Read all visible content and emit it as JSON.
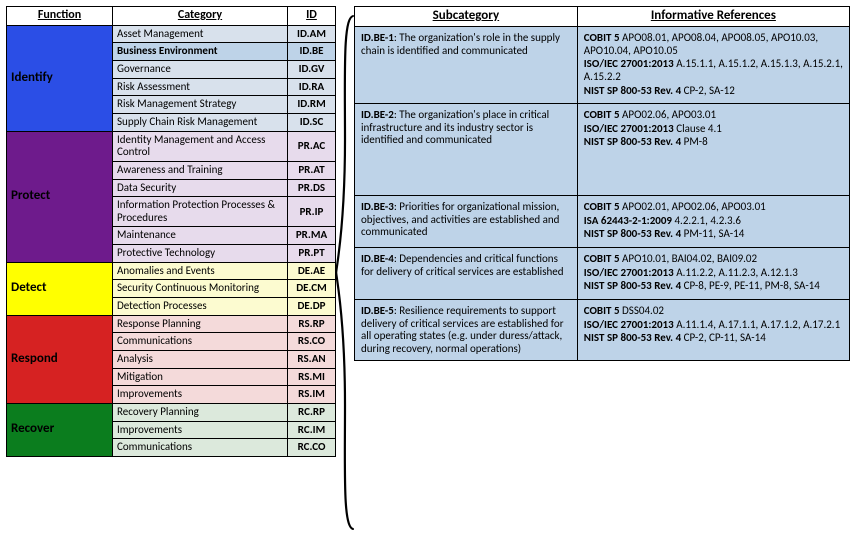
{
  "left": {
    "headers": {
      "function": "Function",
      "category": "Category",
      "id": "ID"
    },
    "groups": [
      {
        "function": "Identify",
        "fnClass": "fn-identify",
        "tint": "tint-identify",
        "rows": [
          {
            "cat": "Asset Management",
            "id": "ID.AM"
          },
          {
            "cat": "Business Environment",
            "id": "ID.BE",
            "highlight": true
          },
          {
            "cat": "Governance",
            "id": "ID.GV"
          },
          {
            "cat": "Risk Assessment",
            "id": "ID.RA"
          },
          {
            "cat": "Risk Management Strategy",
            "id": "ID.RM"
          },
          {
            "cat": "Supply Chain Risk Management",
            "id": "ID.SC"
          }
        ]
      },
      {
        "function": "Protect",
        "fnClass": "fn-protect",
        "tint": "tint-protect",
        "rows": [
          {
            "cat": "Identity Management and Access Control",
            "id": "PR.AC"
          },
          {
            "cat": "Awareness and Training",
            "id": "PR.AT"
          },
          {
            "cat": "Data Security",
            "id": "PR.DS"
          },
          {
            "cat": "Information Protection Processes & Procedures",
            "id": "PR.IP"
          },
          {
            "cat": "Maintenance",
            "id": "PR.MA"
          },
          {
            "cat": "Protective Technology",
            "id": "PR.PT"
          }
        ]
      },
      {
        "function": "Detect",
        "fnClass": "fn-detect",
        "tint": "tint-detect",
        "rows": [
          {
            "cat": "Anomalies and Events",
            "id": "DE.AE"
          },
          {
            "cat": "Security Continuous Monitoring",
            "id": "DE.CM"
          },
          {
            "cat": "Detection Processes",
            "id": "DE.DP"
          }
        ]
      },
      {
        "function": "Respond",
        "fnClass": "fn-respond",
        "tint": "tint-respond",
        "rows": [
          {
            "cat": "Response Planning",
            "id": "RS.RP"
          },
          {
            "cat": "Communications",
            "id": "RS.CO"
          },
          {
            "cat": "Analysis",
            "id": "RS.AN"
          },
          {
            "cat": "Mitigation",
            "id": "RS.MI"
          },
          {
            "cat": "Improvements",
            "id": "RS.IM"
          }
        ]
      },
      {
        "function": "Recover",
        "fnClass": "fn-recover",
        "tint": "tint-recover",
        "rows": [
          {
            "cat": "Recovery Planning",
            "id": "RC.RP"
          },
          {
            "cat": "Improvements",
            "id": "RC.IM"
          },
          {
            "cat": "Communications",
            "id": "RC.CO"
          }
        ]
      }
    ]
  },
  "right": {
    "headers": {
      "subcategory": "Subcategory",
      "references": "Informative References"
    },
    "rows": [
      {
        "code": "ID.BE-1",
        "desc": ": The organization's role in the supply chain is identified and communicated",
        "refs": [
          {
            "label": "COBIT 5",
            "body": " APO08.01, APO08.04, APO08.05, APO10.03, APO10.04, APO10.05"
          },
          {
            "label": "ISO/IEC 27001:2013",
            "body": " A.15.1.1, A.15.1.2, A.15.1.3, A.15.2.1, A.15.2.2"
          },
          {
            "label": "NIST SP 800-53 Rev. 4",
            "body": " CP-2, SA-12"
          }
        ]
      },
      {
        "code": "ID.BE-2",
        "desc": ": The organization's place in critical infrastructure and its industry sector is identified and communicated",
        "extraPad": true,
        "refs": [
          {
            "label": "COBIT 5",
            "body": " APO02.06, APO03.01"
          },
          {
            "label": "ISO/IEC 27001:2013",
            "body": " Clause 4.1"
          },
          {
            "label": "NIST SP 800-53 Rev. 4",
            "body": " PM-8"
          }
        ]
      },
      {
        "code": "ID.BE-3",
        "desc": ": Priorities for organizational mission, objectives, and activities are established and communicated",
        "refs": [
          {
            "label": "COBIT 5",
            "body": " APO02.01, APO02.06, APO03.01"
          },
          {
            "label": "ISA 62443-2-1:2009",
            "body": " 4.2.2.1, 4.2.3.6"
          },
          {
            "label": "NIST SP 800-53 Rev. 4",
            "body": " PM-11, SA-14"
          }
        ]
      },
      {
        "code": "ID.BE-4",
        "desc": ": Dependencies and critical functions for delivery of critical services are established",
        "refs": [
          {
            "label": "COBIT 5",
            "body": " APO10.01, BAI04.02, BAI09.02"
          },
          {
            "label": "ISO/IEC 27001:2013",
            "body": " A.11.2.2, A.11.2.3, A.12.1.3"
          },
          {
            "label": "NIST SP 800-53 Rev. 4",
            "body": " CP-8, PE-9, PE-11, PM-8, SA-14"
          }
        ]
      },
      {
        "code": "ID.BE-5",
        "desc": ": Resilience requirements to support delivery of critical services are established for all operating states (e.g. under duress/attack, during recovery, normal operations)",
        "refs": [
          {
            "label": "COBIT 5",
            "body": " DSS04.02"
          },
          {
            "label": "ISO/IEC 27001:2013",
            "body": " A.11.1.4, A.17.1.1, A.17.1.2, A.17.2.1"
          },
          {
            "label": "NIST SP 800-53 Rev. 4",
            "body": " CP-2, CP-11, SA-14"
          }
        ]
      }
    ]
  }
}
